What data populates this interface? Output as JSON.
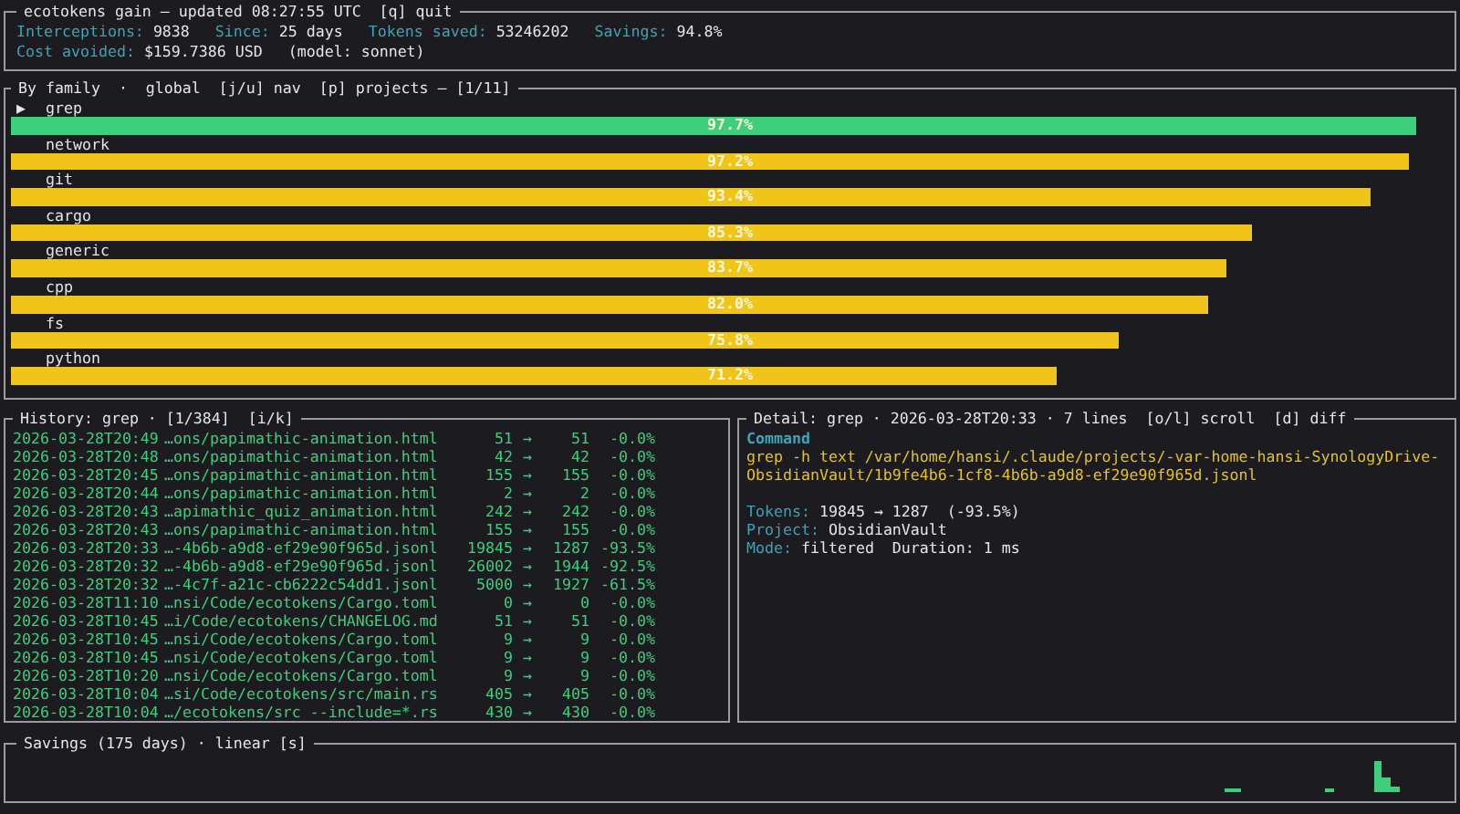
{
  "header": {
    "title": "ecotokens gain – updated 08:27:55 UTC  [q] quit",
    "stats": [
      [
        {
          "label": "Interceptions:",
          "value": "9838"
        },
        {
          "label": "Since:",
          "value": "25 days"
        },
        {
          "label": "Tokens saved:",
          "value": "53246202"
        },
        {
          "label": "Savings:",
          "value": "94.8%"
        }
      ],
      [
        {
          "label": "Cost avoided:",
          "value": "$159.7386 USD"
        },
        {
          "value": "(model: sonnet)"
        }
      ]
    ]
  },
  "families": {
    "title": "By family  ·  global  [j/u] nav  [p] projects – [1/11]",
    "marker": "▶",
    "items": [
      {
        "name": "grep",
        "reading": "97.7%",
        "level": 0.977,
        "selected": true
      },
      {
        "name": "network",
        "reading": "97.2%",
        "level": 0.972,
        "selected": false
      },
      {
        "name": "git",
        "reading": "93.4%",
        "level": 0.945,
        "selected": false
      },
      {
        "name": "cargo",
        "reading": "85.3%",
        "level": 0.863,
        "selected": false
      },
      {
        "name": "generic",
        "reading": "83.7%",
        "level": 0.845,
        "selected": false
      },
      {
        "name": "cpp",
        "reading": "82.0%",
        "level": 0.833,
        "selected": false
      },
      {
        "name": "fs",
        "reading": "75.8%",
        "level": 0.77,
        "selected": false
      },
      {
        "name": "python",
        "reading": "71.2%",
        "level": 0.727,
        "selected": false
      }
    ]
  },
  "history": {
    "title": "History: grep · [1/384]  [i/k]",
    "rows": [
      {
        "time": "2026-03-28T20:49",
        "file": "…ons/papimathic-animation.html",
        "before": "51",
        "arrow": "→",
        "after": "51",
        "change": "-0.0%"
      },
      {
        "time": "2026-03-28T20:48",
        "file": "…ons/papimathic-animation.html",
        "before": "42",
        "arrow": "→",
        "after": "42",
        "change": "-0.0%"
      },
      {
        "time": "2026-03-28T20:45",
        "file": "…ons/papimathic-animation.html",
        "before": "155",
        "arrow": "→",
        "after": "155",
        "change": "-0.0%"
      },
      {
        "time": "2026-03-28T20:44",
        "file": "…ons/papimathic-animation.html",
        "before": "2",
        "arrow": "→",
        "after": "2",
        "change": "-0.0%"
      },
      {
        "time": "2026-03-28T20:43",
        "file": "…apimathic_quiz_animation.html",
        "before": "242",
        "arrow": "→",
        "after": "242",
        "change": "-0.0%"
      },
      {
        "time": "2026-03-28T20:43",
        "file": "…ons/papimathic-animation.html",
        "before": "155",
        "arrow": "→",
        "after": "155",
        "change": "-0.0%"
      },
      {
        "time": "2026-03-28T20:33",
        "file": "…-4b6b-a9d8-ef29e90f965d.jsonl",
        "before": "19845",
        "arrow": "→",
        "after": "1287",
        "change": "-93.5%"
      },
      {
        "time": "2026-03-28T20:32",
        "file": "…-4b6b-a9d8-ef29e90f965d.jsonl",
        "before": "26002",
        "arrow": "→",
        "after": "1944",
        "change": "-92.5%"
      },
      {
        "time": "2026-03-28T20:32",
        "file": "…-4c7f-a21c-cb6222c54dd1.jsonl",
        "before": "5000",
        "arrow": "→",
        "after": "1927",
        "change": "-61.5%"
      },
      {
        "time": "2026-03-28T11:10",
        "file": "…nsi/Code/ecotokens/Cargo.toml",
        "before": "0",
        "arrow": "→",
        "after": "0",
        "change": "-0.0%"
      },
      {
        "time": "2026-03-28T10:45",
        "file": "…i/Code/ecotokens/CHANGELOG.md",
        "before": "51",
        "arrow": "→",
        "after": "51",
        "change": "-0.0%"
      },
      {
        "time": "2026-03-28T10:45",
        "file": "…nsi/Code/ecotokens/Cargo.toml",
        "before": "9",
        "arrow": "→",
        "after": "9",
        "change": "-0.0%"
      },
      {
        "time": "2026-03-28T10:45",
        "file": "…nsi/Code/ecotokens/Cargo.toml",
        "before": "9",
        "arrow": "→",
        "after": "9",
        "change": "-0.0%"
      },
      {
        "time": "2026-03-28T10:20",
        "file": "…nsi/Code/ecotokens/Cargo.toml",
        "before": "9",
        "arrow": "→",
        "after": "9",
        "change": "-0.0%"
      },
      {
        "time": "2026-03-28T10:04",
        "file": "…si/Code/ecotokens/src/main.rs",
        "before": "405",
        "arrow": "→",
        "after": "405",
        "change": "-0.0%"
      },
      {
        "time": "2026-03-28T10:04",
        "file": "…/ecotokens/src --include=*.rs",
        "before": "430",
        "arrow": "→",
        "after": "430",
        "change": "-0.0%"
      }
    ]
  },
  "detail": {
    "title": "Detail: grep · 2026-03-28T20:33 · 7 lines  [o/l] scroll  [d] diff",
    "command_heading": "Command",
    "command": "grep -h text /var/home/hansi/.claude/projects/-var-home-hansi-SynologyDrive-ObsidianVault/1b9fe4b6-1cf8-4b6b-a9d8-ef29e90f965d.jsonl",
    "fields": [
      {
        "label": "Tokens:",
        "value": "19845 → 1287  (-93.5%)"
      },
      {
        "label": "Project:",
        "value": "ObsidianVault"
      },
      {
        "label": "Mode:",
        "value": "filtered  Duration: 1 ms"
      }
    ]
  },
  "savings": {
    "title": "Savings (175 days) · linear [s]"
  }
}
